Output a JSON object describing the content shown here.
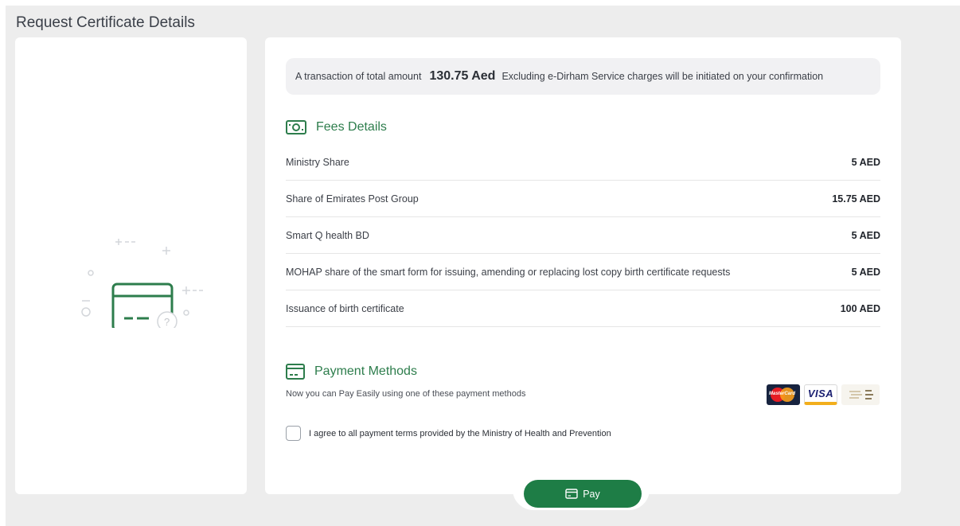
{
  "page": {
    "title": "Request Certificate Details"
  },
  "notice": {
    "prefix": "A transaction of total amount",
    "amount": "130.75 Aed",
    "suffix": "Excluding e-Dirham Service charges will be initiated on your confirmation"
  },
  "fees": {
    "heading": "Fees Details",
    "icon": "money-icon",
    "rows": [
      {
        "label": "Ministry Share",
        "value": "5 AED"
      },
      {
        "label": "Share of Emirates Post Group",
        "value": "15.75 AED"
      },
      {
        "label": "Smart Q health BD",
        "value": "5 AED"
      },
      {
        "label": "MOHAP share of the smart form for issuing, amending or replacing lost copy birth certificate requests",
        "value": "5 AED"
      },
      {
        "label": "Issuance of birth certificate",
        "value": "100 AED"
      }
    ]
  },
  "payment": {
    "heading": "Payment Methods",
    "icon": "credit-card-icon",
    "subtitle": "Now you can Pay Easily using one of these payment methods",
    "methods": [
      "MasterCard",
      "VISA",
      "e-Dirham"
    ],
    "agree_text": "I agree to all payment terms provided by the Ministry of Health and Prevention",
    "agree_checked": false
  },
  "pay_button": {
    "label": "Pay",
    "icon": "credit-card-icon"
  },
  "colors": {
    "accent": "#1e7d46",
    "heading_green": "#2d7d4c",
    "background": "#ededed"
  }
}
